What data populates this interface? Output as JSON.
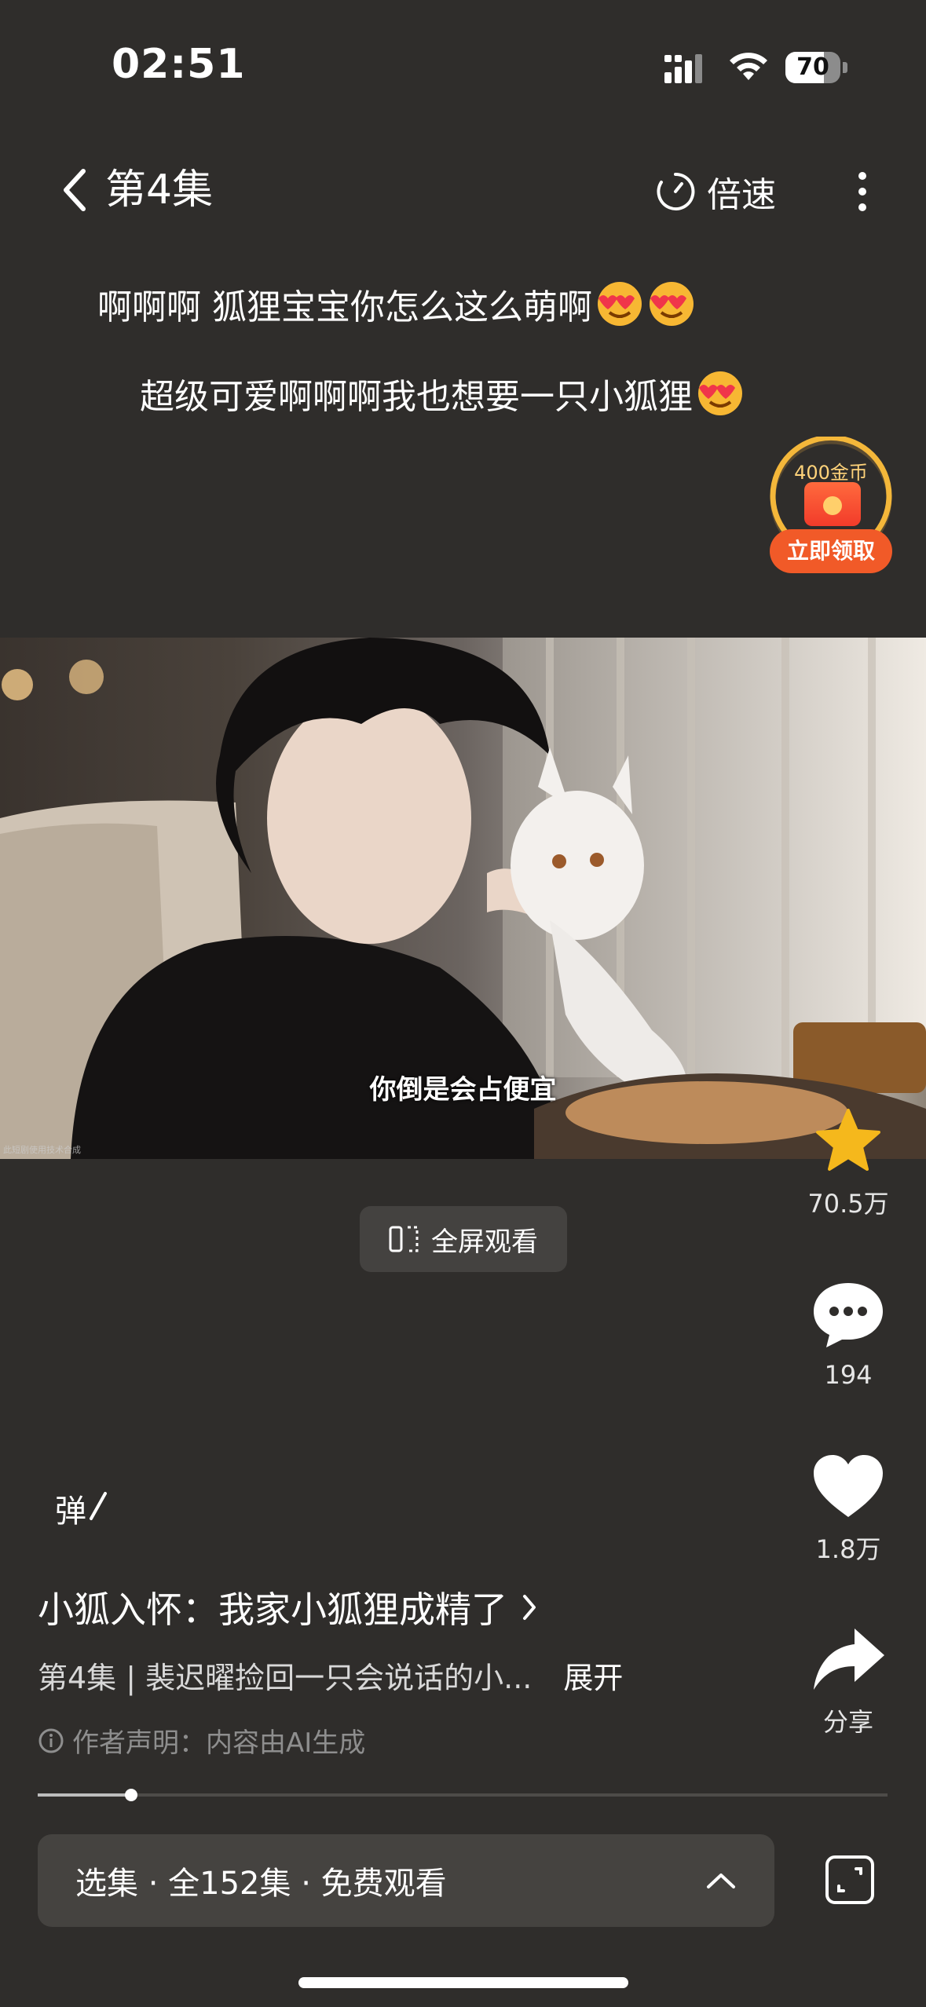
{
  "status_bar": {
    "time": "02:51",
    "battery": "70",
    "battery_level": 0.7
  },
  "nav": {
    "episode_title": "第4集",
    "speed_label": "倍速"
  },
  "danmaku": [
    {
      "text": "啊啊啊 狐狸宝宝你怎么这么萌啊",
      "emoji_count": 2
    },
    {
      "text": "超级可爱啊啊啊我也想要一只小狐狸",
      "emoji_count": 1
    }
  ],
  "coin_reward": {
    "amount_label": "400金币",
    "cta": "立即领取"
  },
  "video": {
    "subtitle": "你倒是会占便宜",
    "watermark": "此短剧使用技术合成"
  },
  "fullscreen": {
    "label": "全屏观看"
  },
  "actions": {
    "favorite_count": "70.5万",
    "comment_count": "194",
    "like_count": "1.8万",
    "share_label": "分享"
  },
  "danmaku_toggle": "弹",
  "drama": {
    "title": "小狐入怀：我家小狐狸成精了",
    "description": "第4集 | 裴迟曜捡回一只会说话的小...",
    "expand": "展开",
    "notice": "作者声明：内容由AI生成"
  },
  "playback": {
    "progress": 0.11
  },
  "episode_bar": {
    "label": "选集 · 全152集 · 免费观看"
  },
  "colors": {
    "background": "#2f2d2b",
    "accent": "#f15a28",
    "star": "#f5b81c"
  }
}
